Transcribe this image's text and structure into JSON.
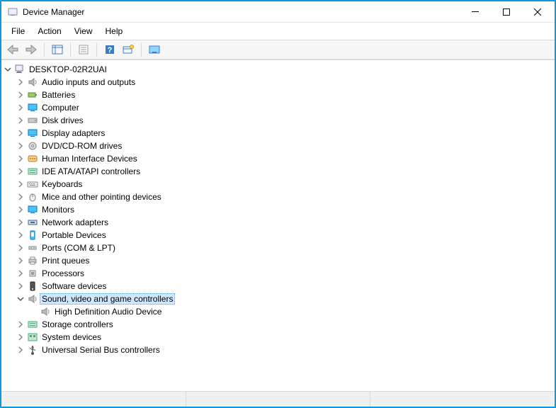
{
  "window": {
    "title": "Device Manager"
  },
  "menu": {
    "file": "File",
    "action": "Action",
    "view": "View",
    "help": "Help"
  },
  "tree": {
    "root": "DESKTOP-02R2UAI",
    "items": [
      {
        "label": "Audio inputs and outputs",
        "icon": "speaker"
      },
      {
        "label": "Batteries",
        "icon": "battery"
      },
      {
        "label": "Computer",
        "icon": "computer"
      },
      {
        "label": "Disk drives",
        "icon": "disk"
      },
      {
        "label": "Display adapters",
        "icon": "display"
      },
      {
        "label": "DVD/CD-ROM drives",
        "icon": "cdrom"
      },
      {
        "label": "Human Interface Devices",
        "icon": "hid"
      },
      {
        "label": "IDE ATA/ATAPI controllers",
        "icon": "ide"
      },
      {
        "label": "Keyboards",
        "icon": "keyboard"
      },
      {
        "label": "Mice and other pointing devices",
        "icon": "mouse"
      },
      {
        "label": "Monitors",
        "icon": "monitor"
      },
      {
        "label": "Network adapters",
        "icon": "network"
      },
      {
        "label": "Portable Devices",
        "icon": "portable"
      },
      {
        "label": "Ports (COM & LPT)",
        "icon": "port"
      },
      {
        "label": "Print queues",
        "icon": "printer"
      },
      {
        "label": "Processors",
        "icon": "cpu"
      },
      {
        "label": "Software devices",
        "icon": "software"
      },
      {
        "label": "Sound, video and game controllers",
        "icon": "sound",
        "expanded": true,
        "selected": true,
        "children": [
          {
            "label": "High Definition Audio Device",
            "icon": "sound"
          }
        ]
      },
      {
        "label": "Storage controllers",
        "icon": "storage"
      },
      {
        "label": "System devices",
        "icon": "system"
      },
      {
        "label": "Universal Serial Bus controllers",
        "icon": "usb"
      }
    ]
  }
}
